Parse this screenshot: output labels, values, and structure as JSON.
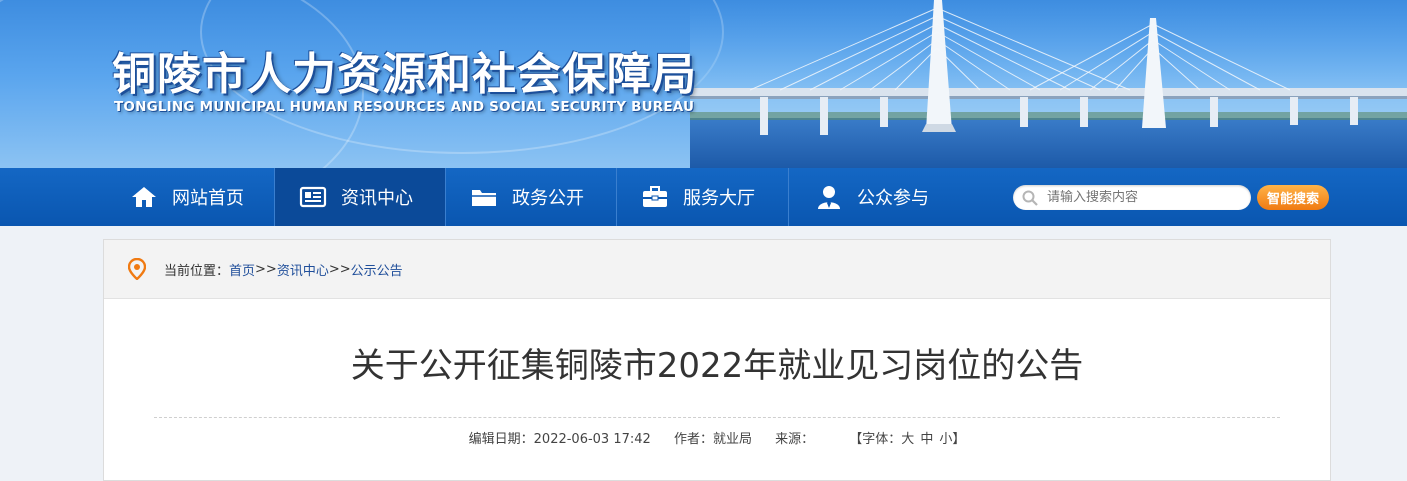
{
  "header": {
    "title": "铜陵市人力资源和社会保障局",
    "subtitle": "TONGLING MUNICIPAL HUMAN RESOURCES AND SOCIAL SECURITY BUREAU"
  },
  "nav": {
    "items": [
      {
        "label": "网站首页",
        "icon": "home-icon"
      },
      {
        "label": "资讯中心",
        "icon": "news-icon"
      },
      {
        "label": "政务公开",
        "icon": "folder-icon"
      },
      {
        "label": "服务大厅",
        "icon": "briefcase-icon"
      },
      {
        "label": "公众参与",
        "icon": "user-icon"
      }
    ],
    "active_index": 1
  },
  "search": {
    "placeholder": "请输入搜索内容",
    "button_label": "智能搜索"
  },
  "breadcrumb": {
    "prefix": "当前位置：",
    "items": [
      "首页",
      "资讯中心",
      "公示公告"
    ],
    "separator": ">>"
  },
  "article": {
    "title": "关于公开征集铜陵市2022年就业见习岗位的公告",
    "edit_date_label": "编辑日期：",
    "edit_date": "2022-06-03 17:42",
    "author_label": "作者：",
    "author": "就业局",
    "source_label": "来源：",
    "source": "",
    "font_label_open": "【字体：",
    "font_large": "大",
    "font_medium": "中",
    "font_small": "小",
    "font_label_close": "】"
  },
  "colors": {
    "nav_bg": "#0a56b0",
    "nav_active": "#0b4a99",
    "search_button": "#f07a12",
    "location_pin": "#f07a12"
  }
}
